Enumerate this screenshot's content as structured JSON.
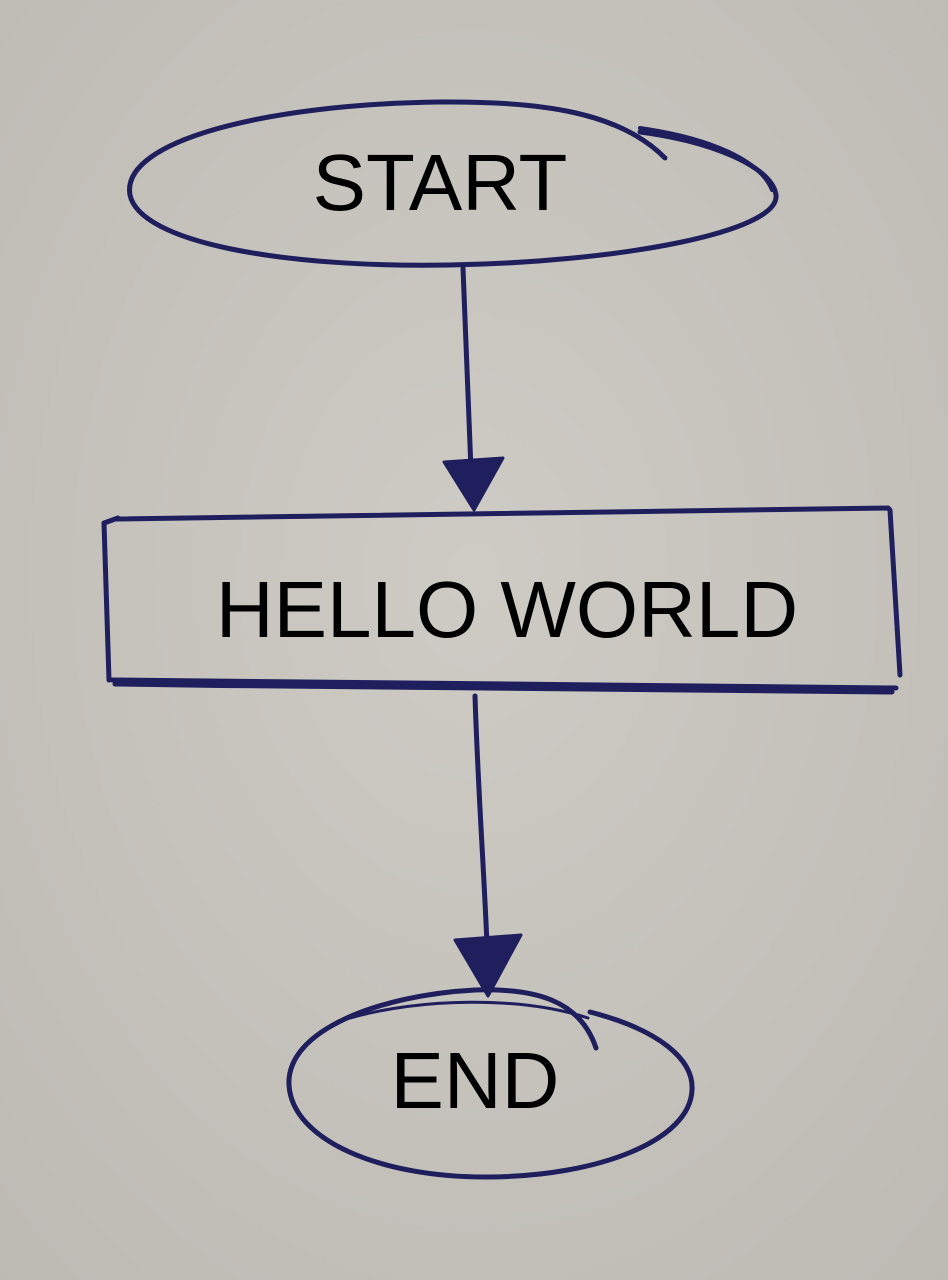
{
  "colors": {
    "paper": "#c9c6c0",
    "ink": "#1f1f5e",
    "text": "#000000"
  },
  "nodes": [
    {
      "id": "start",
      "shape": "terminator",
      "label": "START"
    },
    {
      "id": "process",
      "shape": "process",
      "label": "HELLO WORLD"
    },
    {
      "id": "end",
      "shape": "terminator",
      "label": "END"
    }
  ],
  "edges": [
    {
      "from": "start",
      "to": "process"
    },
    {
      "from": "process",
      "to": "end"
    }
  ]
}
